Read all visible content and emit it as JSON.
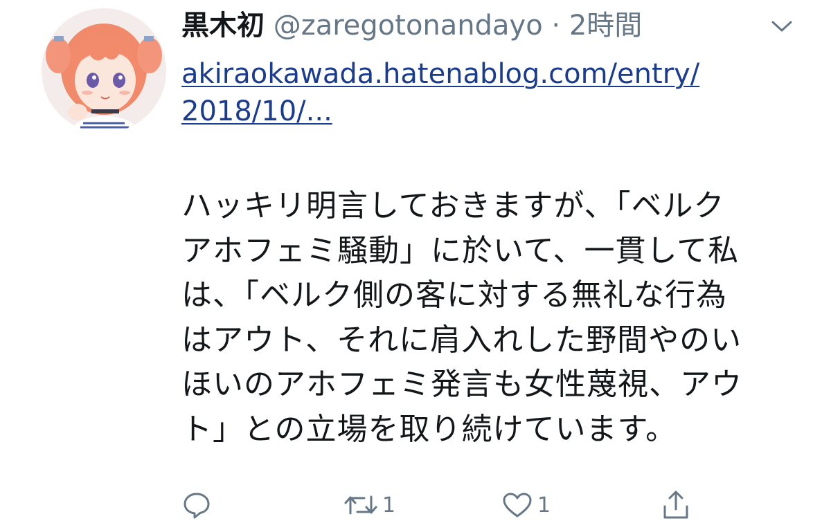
{
  "tweet": {
    "display_name": "黒木初",
    "handle": "@zaregotonandayo",
    "separator": "·",
    "time": "2時間",
    "link_lines": [
      "akiraokawada.hatenablog.com/entry/",
      "2018/10/..."
    ],
    "body_lines": [
      "ハッキリ明言しておきますが、「ベルク",
      "アホフェミ騒動」に於いて、一貫して私",
      "は、「ベルク側の客に対する無礼な行為",
      "はアウト、それに肩入れした野間やのい",
      "ほいのアホフェミ発言も女性蔑視、アウ",
      "ト」との立場を取り続けています。"
    ],
    "actions": {
      "reply_icon": "speech-bubble-icon",
      "retweet_icon": "retweet-icon",
      "retweet_count": "1",
      "like_icon": "heart-icon",
      "like_count": "1",
      "share_icon": "share-icon"
    }
  },
  "colors": {
    "text": "#14171a",
    "muted": "#657786",
    "link": "#1b3c8c"
  }
}
